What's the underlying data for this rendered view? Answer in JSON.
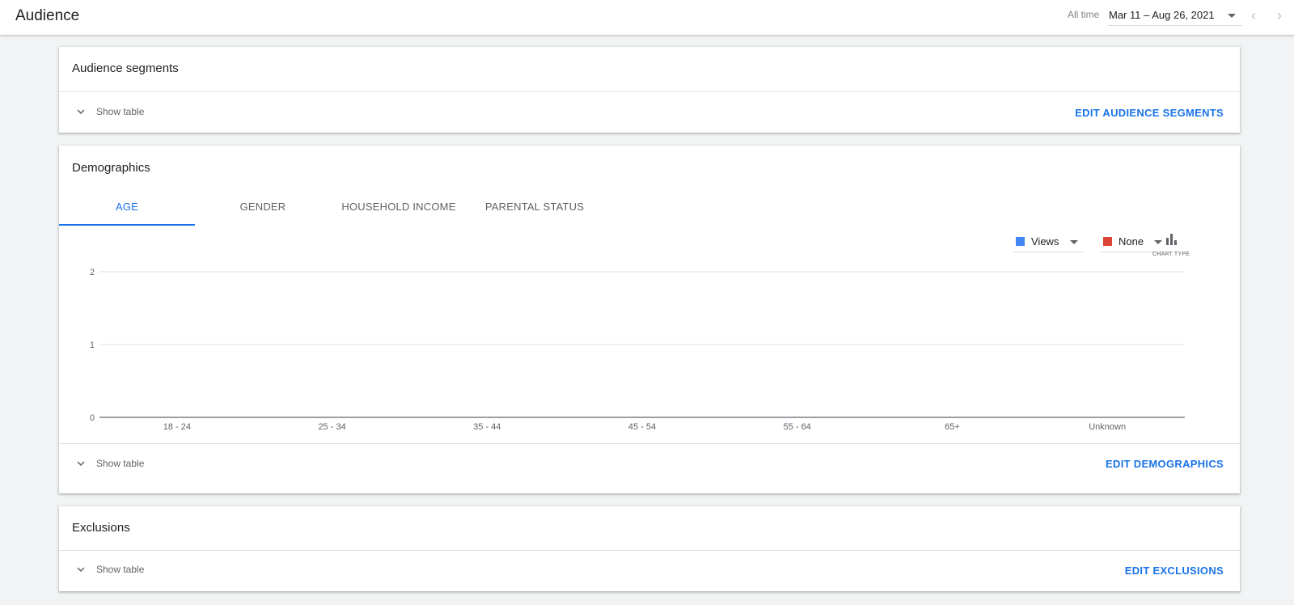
{
  "header": {
    "title": "Audience",
    "range_label": "All time",
    "date_range": "Mar 11 – Aug 26, 2021"
  },
  "audience_segments": {
    "title": "Audience segments",
    "show_table_label": "Show table",
    "edit_label": "EDIT AUDIENCE SEGMENTS"
  },
  "demographics": {
    "title": "Demographics",
    "tabs": [
      {
        "label": "AGE",
        "active": true
      },
      {
        "label": "GENDER",
        "active": false
      },
      {
        "label": "HOUSEHOLD INCOME",
        "active": false
      },
      {
        "label": "PARENTAL STATUS",
        "active": false
      }
    ],
    "metric_primary": {
      "label": "Views",
      "color": "#4285f4"
    },
    "metric_secondary": {
      "label": "None",
      "color": "#db4437"
    },
    "chart_type_label": "CHART TYPE",
    "show_table_label": "Show table",
    "edit_label": "EDIT DEMOGRAPHICS"
  },
  "exclusions": {
    "title": "Exclusions",
    "show_table_label": "Show table",
    "edit_label": "EDIT EXCLUSIONS"
  },
  "chart_data": {
    "type": "bar",
    "title": "",
    "xlabel": "",
    "ylabel": "",
    "categories": [
      "18 - 24",
      "25 - 34",
      "35 - 44",
      "45 - 54",
      "55 - 64",
      "65+",
      "Unknown"
    ],
    "series": [
      {
        "name": "Views",
        "color": "#4285f4",
        "values": [
          0,
          0,
          0,
          0,
          0,
          0,
          0
        ]
      }
    ],
    "ylim": [
      0,
      2
    ],
    "yticks": [
      0,
      1,
      2
    ],
    "grid": true,
    "legend": "top-right"
  }
}
